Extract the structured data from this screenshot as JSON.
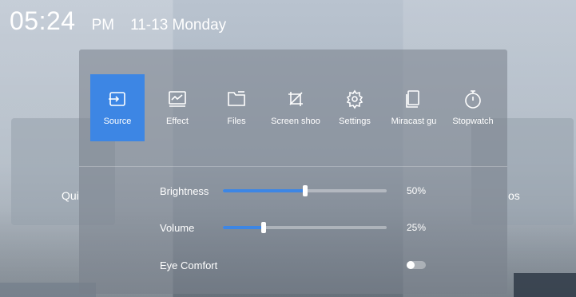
{
  "header": {
    "time": "05:24",
    "ampm": "PM",
    "date": "11-13 Monday"
  },
  "background": {
    "left_label": "Qui",
    "right_label": "os"
  },
  "apps": [
    {
      "label": "Source",
      "icon": "source-icon",
      "active": true
    },
    {
      "label": "Effect",
      "icon": "effect-icon",
      "active": false
    },
    {
      "label": "Files",
      "icon": "folder-icon",
      "active": false
    },
    {
      "label": "Screen shoo",
      "icon": "screenshot-icon",
      "active": false
    },
    {
      "label": "Settings",
      "icon": "gear-icon",
      "active": false
    },
    {
      "label": "Miracast gu",
      "icon": "miracast-icon",
      "active": false
    },
    {
      "label": "Stopwatch",
      "icon": "stopwatch-icon",
      "active": false
    }
  ],
  "controls": {
    "brightness": {
      "label": "Brightness",
      "value_text": "50%",
      "level": 0.5
    },
    "volume": {
      "label": "Volume",
      "value_text": "25%",
      "level": 0.25
    },
    "eye_comfort": {
      "label": "Eye Comfort",
      "on": false
    }
  },
  "colors": {
    "accent": "#3d86e4"
  }
}
